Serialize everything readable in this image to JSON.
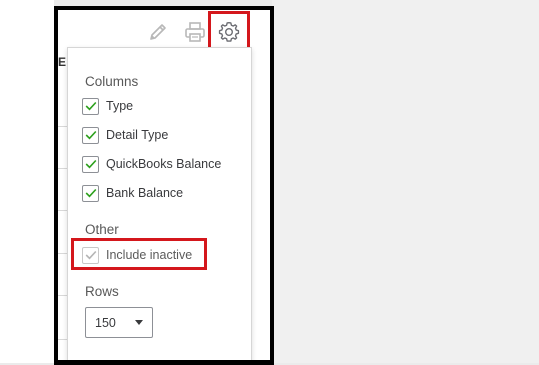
{
  "toolbar": {
    "icons": [
      "pencil-icon",
      "printer-icon",
      "gear-icon"
    ]
  },
  "settings_panel": {
    "columns_heading": "Columns",
    "columns": [
      {
        "label": "Type",
        "checked": true
      },
      {
        "label": "Detail Type",
        "checked": true
      },
      {
        "label": "QuickBooks Balance",
        "checked": true
      },
      {
        "label": "Bank Balance",
        "checked": true
      }
    ],
    "other_heading": "Other",
    "other": [
      {
        "label": "Include inactive",
        "checked": true,
        "disabled": true
      }
    ],
    "rows_heading": "Rows",
    "rows_value": "150"
  },
  "colors": {
    "check_green": "#2ca01c",
    "check_disabled": "#b5b5b5",
    "highlight_red": "#d4171c",
    "frame_border": "#000000"
  }
}
